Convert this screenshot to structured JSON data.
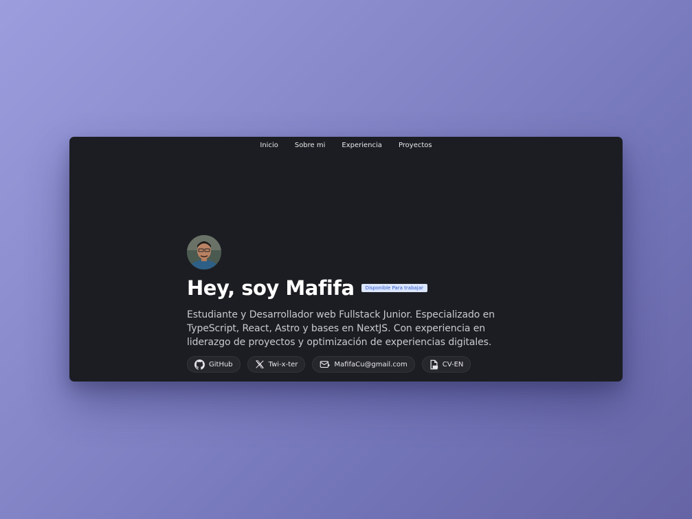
{
  "nav": {
    "items": [
      {
        "label": "Inicio"
      },
      {
        "label": "Sobre mi"
      },
      {
        "label": "Experiencia"
      },
      {
        "label": "Proyectos"
      }
    ]
  },
  "hero": {
    "title": "Hey, soy Mafifa",
    "badge": "Disponible Para trabajar",
    "description": "Estudiante y Desarrollador web Fullstack Junior. Especializado en TypeScript, React, Astro y bases en NextJS. Con experiencia en liderazgo de proyectos y optimización de experiencias digitales."
  },
  "links": [
    {
      "label": "GitHub",
      "icon": "github-icon"
    },
    {
      "label": "Twi-x-ter",
      "icon": "x-icon"
    },
    {
      "label": "MafifaCu@gmail.com",
      "icon": "mail-icon"
    },
    {
      "label": "CV-EN",
      "icon": "pdf-file-icon"
    }
  ],
  "colors": {
    "background_start": "#9b9ddd",
    "background_end": "#6664a4",
    "window": "#1c1d22",
    "badge_bg": "#dbe6ff",
    "badge_text": "#2f57c9"
  }
}
